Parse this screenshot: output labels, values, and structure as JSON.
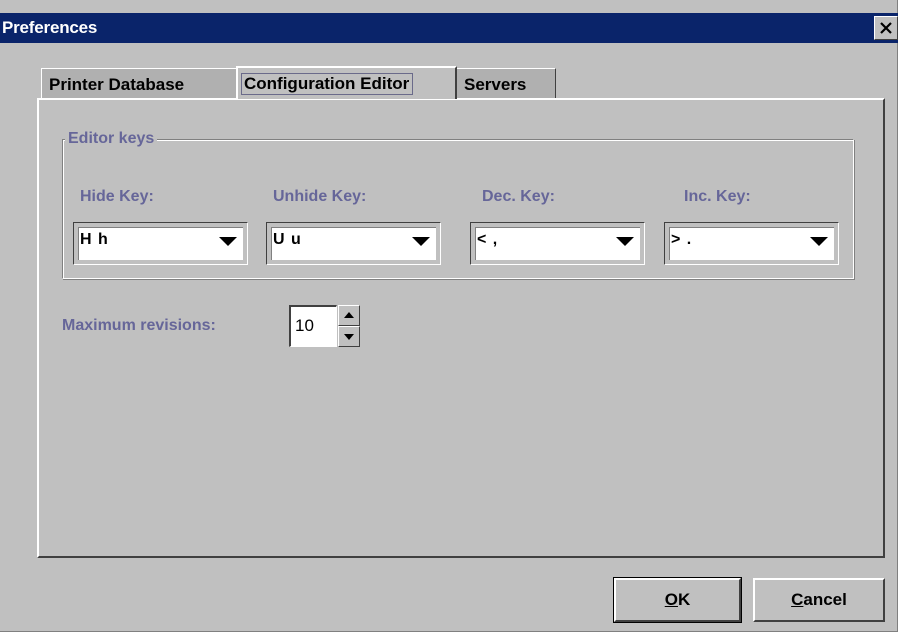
{
  "window": {
    "title": "Preferences",
    "close_glyph": "✕"
  },
  "tabs": [
    {
      "label": "Printer Database",
      "active": false
    },
    {
      "label": "Configuration Editor",
      "active": true
    },
    {
      "label": "Servers",
      "active": false
    }
  ],
  "editor_keys": {
    "legend": "Editor keys",
    "hide": {
      "label": "Hide Key:",
      "value": "H h"
    },
    "unhide": {
      "label": "Unhide Key:",
      "value": "U u"
    },
    "dec": {
      "label": "Dec. Key:",
      "value": "< ,"
    },
    "inc": {
      "label": "Inc. Key:",
      "value": "> ."
    }
  },
  "revisions": {
    "label": "Maximum revisions:",
    "value": "10"
  },
  "buttons": {
    "ok": {
      "mnemonic": "O",
      "rest": "K"
    },
    "cancel": {
      "mnemonic": "C",
      "rest": "ancel"
    }
  },
  "colors": {
    "titlebar": "#0a246a",
    "label": "#666699",
    "face": "#c0c0c0"
  },
  "icons": {
    "close": "close-icon",
    "dropdown": "chevron-down-icon",
    "spin_up": "arrow-up-icon",
    "spin_down": "arrow-down-icon"
  }
}
